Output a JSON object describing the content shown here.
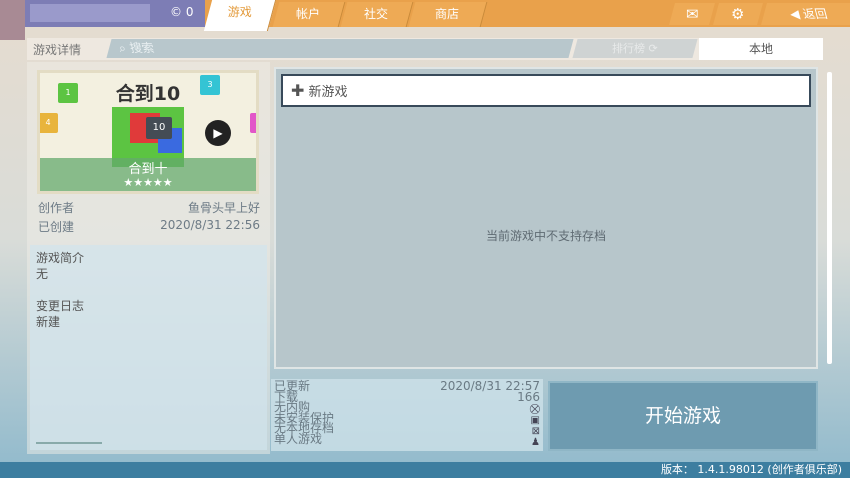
{
  "topbar": {
    "coins": "0",
    "tabs": [
      "游戏",
      "帐户",
      "社交",
      "商店"
    ],
    "active_tab": "游戏",
    "icons": [
      "mail-icon",
      "gear-icon",
      "back-arrow-icon"
    ],
    "back_label": "返回"
  },
  "subbar": {
    "title": "游戏详情",
    "search_placeholder": "搜索",
    "rank_label": "排行榜",
    "local_label": "本地"
  },
  "game": {
    "title_art": "合到10",
    "name": "合到十",
    "stars": "★★★★★",
    "rating": 5,
    "creator_label": "创作者",
    "creator": "鱼骨头早上好",
    "created_label": "已创建",
    "created": "2020/8/31 22:56",
    "intro_label": "游戏简介",
    "intro": "无",
    "changelog_label": "变更日志",
    "changelog": "新建"
  },
  "saves": {
    "new_game": "新游戏",
    "empty_message": "当前游戏中不支持存档"
  },
  "info": {
    "updated_label": "已更新",
    "updated": "2020/8/31 22:57",
    "downloads_label": "下载",
    "downloads": "166",
    "iap_label": "无内购",
    "protection_label": "未安装保护",
    "local_save_label": "无本地存档",
    "single_label": "单人游戏"
  },
  "start_button": "开始游戏",
  "footer": {
    "version": "版本： 1.4.1.98012 (创作者俱乐部)"
  }
}
